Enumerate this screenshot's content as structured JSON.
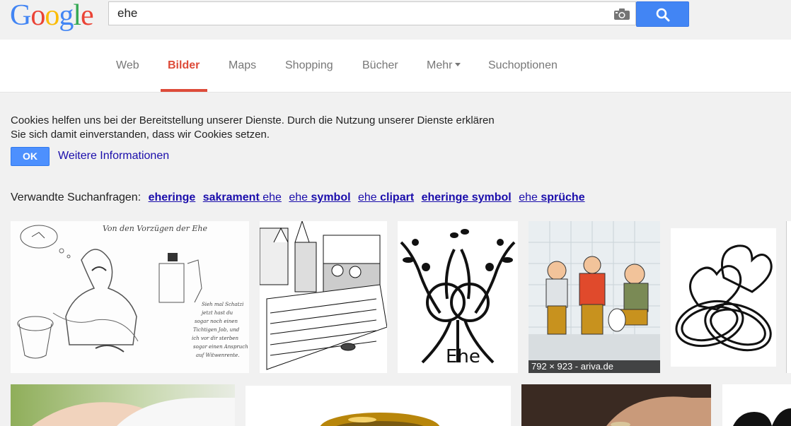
{
  "logo": {
    "letters": [
      "G",
      "o",
      "o",
      "g",
      "l",
      "e"
    ],
    "colors": [
      "#4285f4",
      "#ea4335",
      "#fbbc05",
      "#4285f4",
      "#34a853",
      "#ea4335"
    ]
  },
  "search": {
    "value": "ehe",
    "camera_icon": "camera-icon",
    "button_icon": "search-icon",
    "button_color": "#4285f4"
  },
  "nav": {
    "items": [
      "Web",
      "Bilder",
      "Maps",
      "Shopping",
      "Bücher",
      "Mehr",
      "Suchoptionen"
    ],
    "active_item": "Bilder",
    "active_color": "#dd4b39"
  },
  "cookie": {
    "text": "Cookies helfen uns bei der Bereitstellung unserer Dienste. Durch die Nutzung unserer Dienste erklären Sie sich damit einverstanden, dass wir Cookies setzen.",
    "ok_label": "OK",
    "more_label": "Weitere Informationen"
  },
  "related": {
    "prefix": "Verwandte Suchanfragen:",
    "links": [
      {
        "bold": "eheringe",
        "normal_before": "",
        "normal_after": ""
      },
      {
        "bold": "sakrament",
        "normal_before": "",
        "normal_after": " ehe"
      },
      {
        "bold": "symbol",
        "normal_before": "ehe ",
        "normal_after": ""
      },
      {
        "bold": "clipart",
        "normal_before": "ehe ",
        "normal_after": ""
      },
      {
        "bold": "eheringe symbol",
        "normal_before": "",
        "normal_after": ""
      },
      {
        "bold": "sprüche",
        "normal_before": "ehe ",
        "normal_after": ""
      }
    ]
  },
  "images": {
    "thumb1_title": "Von den Vorzügen der Ehe",
    "thumb1_note": "Sieh mal Schatzi- jetzt hast du sogar noch einen Tichtigen Job, und wenn ich vor dir sterben sollte, sogar einen Anspruch auf Witwenrente.",
    "thumb3_word": "Ehe",
    "thumb4_caption": "792 × 923 - ariva.de"
  }
}
